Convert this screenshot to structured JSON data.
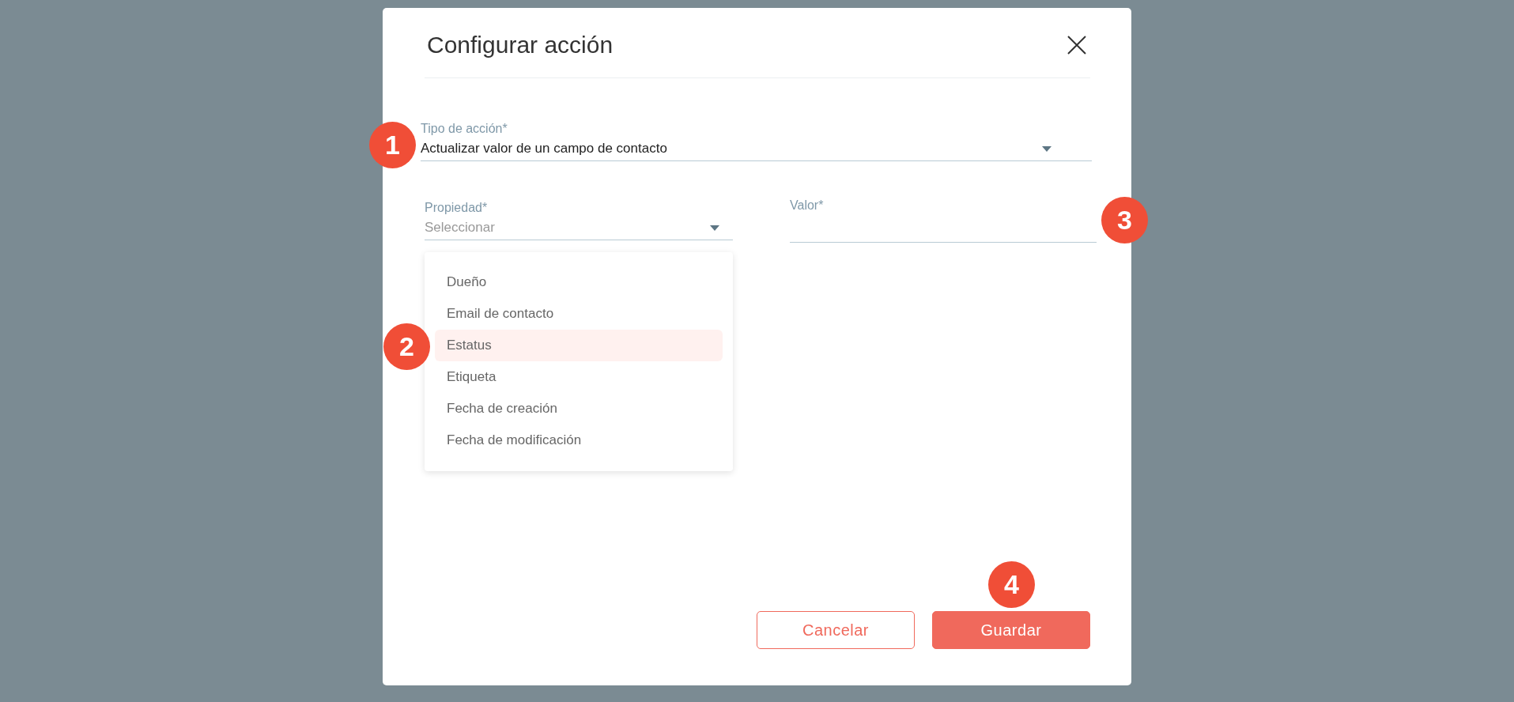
{
  "dialog": {
    "title": "Configurar acción"
  },
  "action_type": {
    "label": "Tipo de acción*",
    "value": "Actualizar valor de un campo de contacto"
  },
  "property": {
    "label": "Propiedad*",
    "placeholder": "Seleccionar",
    "expanded": true,
    "options": [
      {
        "label": "Dueño",
        "selected": false
      },
      {
        "label": "Email de contacto",
        "selected": false
      },
      {
        "label": "Estatus",
        "selected": true
      },
      {
        "label": "Etiqueta",
        "selected": false
      },
      {
        "label": "Fecha de creación",
        "selected": false
      },
      {
        "label": "Fecha de modificación",
        "selected": false
      }
    ]
  },
  "value_field": {
    "label": "Valor*"
  },
  "buttons": [
    {
      "label": "Cancelar",
      "kind": "secondary"
    },
    {
      "label": "Guardar",
      "kind": "primary"
    }
  ],
  "callouts": [
    "1",
    "2",
    "3",
    "4"
  ]
}
